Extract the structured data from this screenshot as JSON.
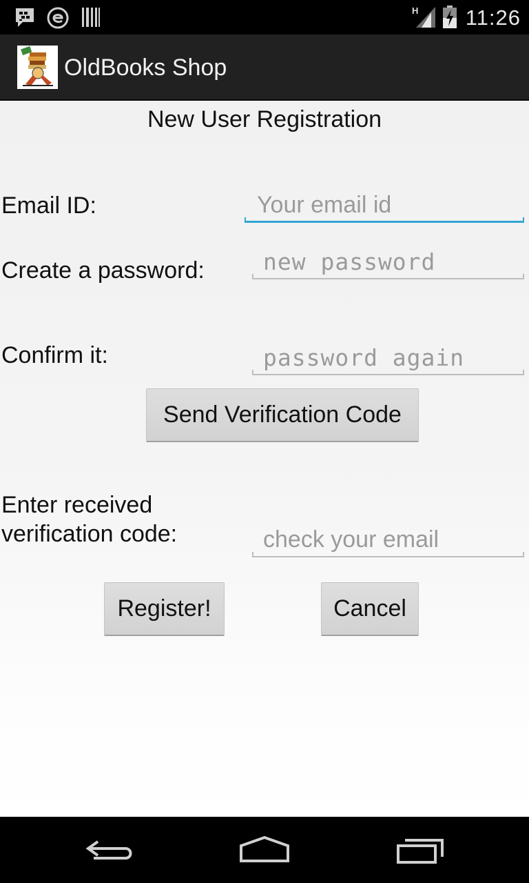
{
  "status_bar": {
    "time": "11:26",
    "icons": [
      "bbm-icon",
      "e-icon",
      "barcode-icon",
      "signal-icon",
      "battery-icon"
    ],
    "network_type": "H"
  },
  "action_bar": {
    "title": "OldBooks Shop",
    "logo_icon": "book-courier-logo"
  },
  "form": {
    "heading": "New User Registration",
    "email_label": "Email ID:",
    "email_placeholder": "Your email id",
    "email_value": "",
    "password_label": "Create a password:",
    "password_placeholder": "new password",
    "password_value": "",
    "confirm_label": "Confirm it:",
    "confirm_placeholder": "password again",
    "confirm_value": "",
    "send_code_button": "Send Verification Code",
    "code_label_line1": "Enter received",
    "code_label_line2": "verification code:",
    "code_placeholder": "check your email",
    "code_value": "",
    "register_button": "Register!",
    "cancel_button": "Cancel"
  },
  "nav_bar": {
    "buttons": [
      "back-icon",
      "home-icon",
      "recents-icon"
    ]
  },
  "colors": {
    "focus_accent": "#33a5d3",
    "action_bar": "#212121",
    "button": "#d6d6d6"
  }
}
